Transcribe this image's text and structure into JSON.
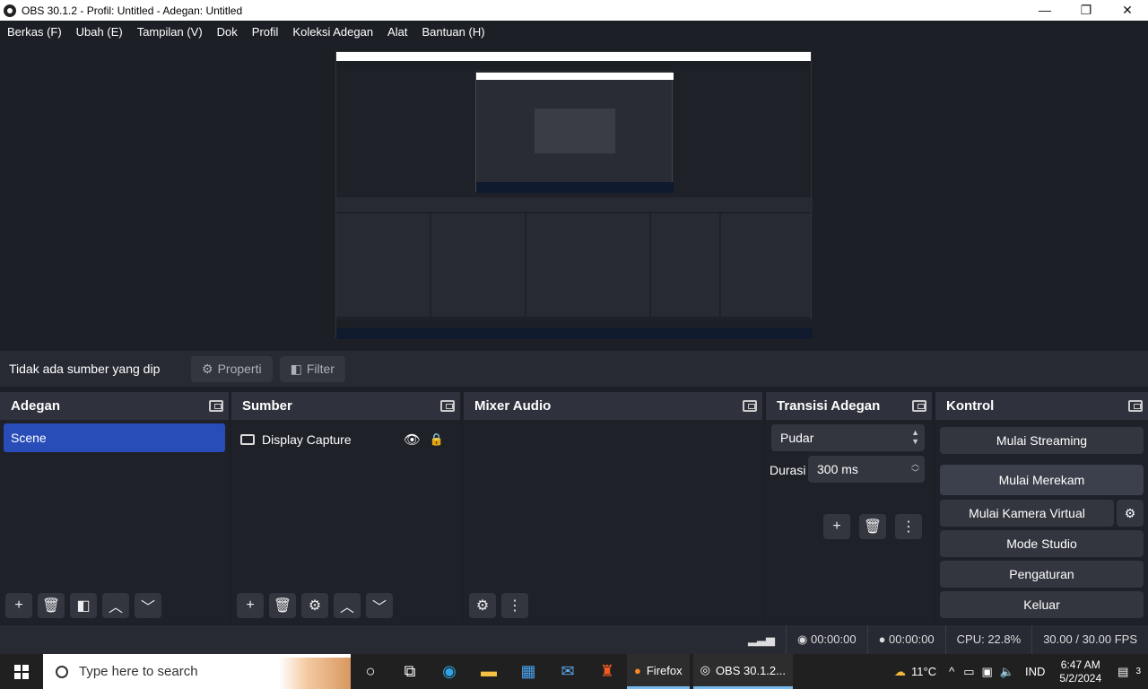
{
  "window": {
    "title": "OBS 30.1.2 - Profil: Untitled - Adegan: Untitled",
    "minimize": "—",
    "maximize": "❐",
    "close": "✕"
  },
  "menu": [
    "Berkas (F)",
    "Ubah (E)",
    "Tampilan (V)",
    "Dok",
    "Profil",
    "Koleksi Adegan",
    "Alat",
    "Bantuan (H)"
  ],
  "toolbar": {
    "no_source": "Tidak ada sumber yang dip",
    "properties": "Properti",
    "filter": "Filter"
  },
  "docks": {
    "scenes": {
      "title": "Adegan",
      "items": [
        "Scene"
      ]
    },
    "sources": {
      "title": "Sumber",
      "items": [
        "Display Capture"
      ]
    },
    "mixer": {
      "title": "Mixer Audio"
    },
    "transitions": {
      "title": "Transisi Adegan",
      "type": "Pudar",
      "duration_label": "Durasi",
      "duration": "300 ms"
    },
    "controls": {
      "title": "Kontrol",
      "start_streaming": "Mulai Streaming",
      "start_recording": "Mulai Merekam",
      "virtual_camera": "Mulai Kamera Virtual",
      "studio_mode": "Mode Studio",
      "settings": "Pengaturan",
      "exit": "Keluar"
    }
  },
  "status": {
    "stream_time": "00:00:00",
    "record_time": "00:00:00",
    "cpu": "CPU: 22.8%",
    "fps": "30.00 / 30.00 FPS"
  },
  "taskbar": {
    "search_placeholder": "Type here to search",
    "apps": [
      "Firefox",
      "OBS 30.1.2..."
    ],
    "weather": "11°C",
    "language": "IND",
    "time": "6:47 AM",
    "date": "5/2/2024",
    "notifications": "3"
  }
}
